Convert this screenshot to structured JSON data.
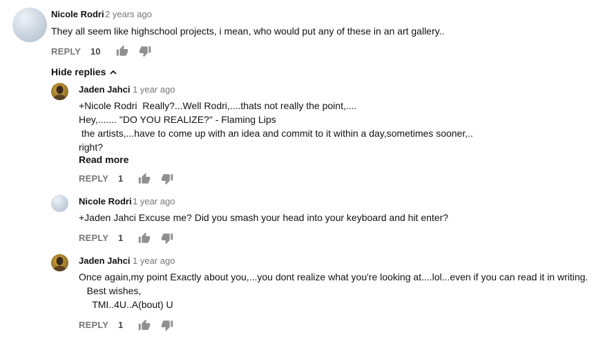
{
  "comment": {
    "author": "Nicole Rodri",
    "time": "2 years ago",
    "text": "They all seem like highschool projects, i mean, who would put any of these in an art gallery..",
    "reply_label": "REPLY",
    "likes": "10"
  },
  "hide_replies_label": "Hide replies",
  "replies": [
    {
      "author": "Jaden Jahci",
      "time": "1 year ago",
      "lines": [
        "+Nicole Rodri  Really?...Well Rodri,....thats not really the point,....",
        "Hey,....... \"DO YOU REALIZE?\" - Flaming Lips",
        " the artists,...have to come up with an idea and commit to it within a day,sometimes sooner,..",
        "right?"
      ],
      "read_more": "Read more",
      "reply_label": "REPLY",
      "likes": "1"
    },
    {
      "author": "Nicole Rodri",
      "time": "1 year ago",
      "lines": [
        "+Jaden Jahci Excuse me? Did you smash your head into your keyboard and hit enter?"
      ],
      "reply_label": "REPLY",
      "likes": "1"
    },
    {
      "author": "Jaden Jahci",
      "time": "1 year ago",
      "lines": [
        "Once again,my point Exactly about you,...you dont realize what you're looking at....lol...even if you can read it in writing.",
        "   Best wishes,",
        "     TMI..4U..A(bout) U"
      ],
      "reply_label": "REPLY",
      "likes": "1"
    }
  ]
}
